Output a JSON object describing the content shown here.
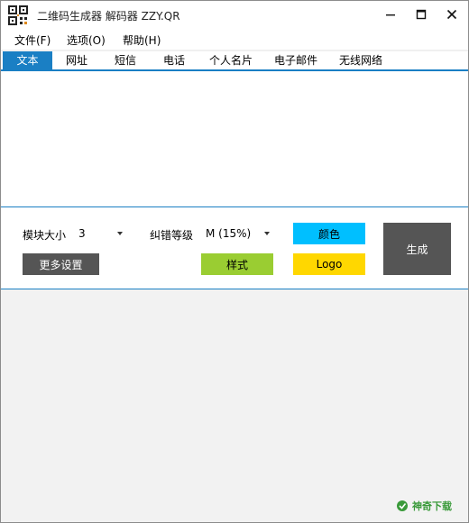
{
  "window": {
    "title": "二维码生成器 解码器 ZZY.QR",
    "icon": "qr-code-icon",
    "controls": [
      "minimize-icon",
      "maximize-icon",
      "close-icon"
    ]
  },
  "menu": {
    "items": [
      {
        "label": "文件(F)"
      },
      {
        "label": "选项(O)"
      },
      {
        "label": "帮助(H)"
      }
    ]
  },
  "tabs": {
    "items": [
      {
        "label": "文本",
        "active": true
      },
      {
        "label": "网址"
      },
      {
        "label": "短信"
      },
      {
        "label": "电话"
      },
      {
        "label": "个人名片"
      },
      {
        "label": "电子邮件"
      },
      {
        "label": "无线网络"
      }
    ]
  },
  "input": {
    "value": ""
  },
  "controls": {
    "module_size_label": "模块大小",
    "module_size_value": "3",
    "ecc_label": "纠错等级",
    "ecc_value": "M (15%)",
    "more_settings": "更多设置",
    "style": "样式",
    "color": "颜色",
    "logo": "Logo",
    "generate": "生成"
  },
  "colors": {
    "accent": "#1a7fc4",
    "style_button": "#9acd32",
    "color_button": "#00bfff",
    "logo_button": "#ffd700",
    "dark_button": "#555555"
  },
  "watermark": {
    "text": "神奇下载"
  }
}
